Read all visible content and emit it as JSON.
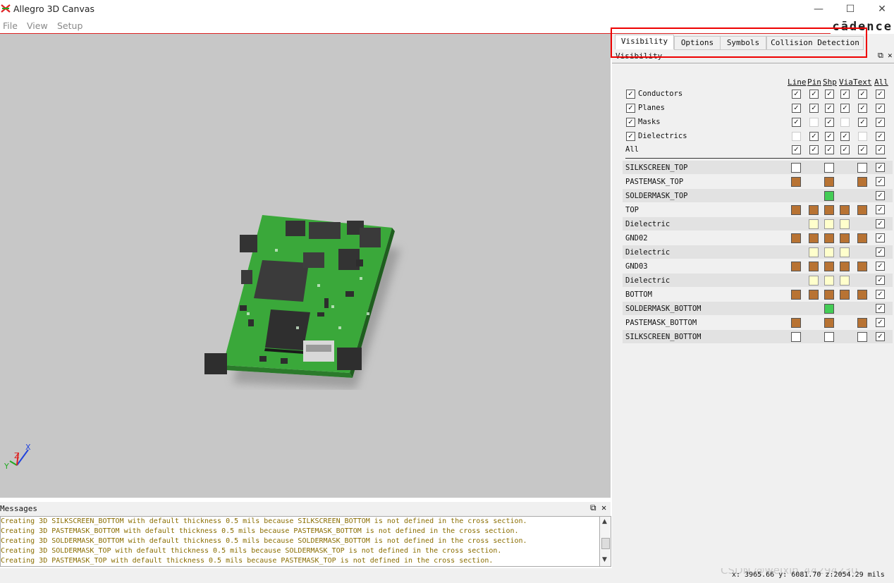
{
  "window": {
    "title": "Allegro 3D Canvas",
    "controls": {
      "minimize": "—",
      "maximize": "☐",
      "close": "✕"
    }
  },
  "menu": [
    "File",
    "View",
    "Setup"
  ],
  "brand": "cādence",
  "panel": {
    "tabs": [
      "Visibility",
      "Options",
      "Symbols",
      "Collision Detection"
    ],
    "active_tab": "Visibility",
    "section_title": "Visibility",
    "columns": [
      "Line",
      "Pin",
      "Shp",
      "Via",
      "Text",
      "All"
    ],
    "categories": [
      {
        "label": "Conductors",
        "checked": true,
        "cells": [
          "on",
          "on",
          "on",
          "on",
          "on",
          "on"
        ]
      },
      {
        "label": "Planes",
        "checked": true,
        "cells": [
          "on",
          "on",
          "on",
          "on",
          "on",
          "on"
        ]
      },
      {
        "label": "Masks",
        "checked": true,
        "cells": [
          "on",
          "off",
          "on",
          "off",
          "on",
          "on"
        ]
      },
      {
        "label": "Dielectrics",
        "checked": true,
        "cells": [
          "off",
          "on",
          "on",
          "on",
          "off",
          "on"
        ]
      },
      {
        "label": "All",
        "checked": null,
        "cells": [
          "on",
          "on",
          "on",
          "on",
          "on",
          "on"
        ]
      }
    ],
    "colors": {
      "copper": "#b87333",
      "dielectric": "#ffffcc",
      "mask_green": "#44cc55",
      "white": "#ffffff"
    },
    "layers": [
      {
        "name": "SILKSCREEN_TOP",
        "cells": [
          "white",
          null,
          "white",
          null,
          "white",
          "check"
        ]
      },
      {
        "name": "PASTEMASK_TOP",
        "cells": [
          "copper",
          null,
          "copper",
          null,
          "copper",
          "check"
        ]
      },
      {
        "name": "SOLDERMASK_TOP",
        "cells": [
          null,
          null,
          "mask_green",
          null,
          null,
          "check"
        ]
      },
      {
        "name": "TOP",
        "cells": [
          "copper",
          "copper",
          "copper",
          "copper",
          "copper",
          "check"
        ]
      },
      {
        "name": "Dielectric",
        "cells": [
          null,
          "dielectric",
          "dielectric",
          "dielectric",
          null,
          "check"
        ]
      },
      {
        "name": "GND02",
        "cells": [
          "copper",
          "copper",
          "copper",
          "copper",
          "copper",
          "check"
        ]
      },
      {
        "name": "Dielectric",
        "cells": [
          null,
          "dielectric",
          "dielectric",
          "dielectric",
          null,
          "check"
        ]
      },
      {
        "name": "GND03",
        "cells": [
          "copper",
          "copper",
          "copper",
          "copper",
          "copper",
          "check"
        ]
      },
      {
        "name": "Dielectric",
        "cells": [
          null,
          "dielectric",
          "dielectric",
          "dielectric",
          null,
          "check"
        ]
      },
      {
        "name": "BOTTOM",
        "cells": [
          "copper",
          "copper",
          "copper",
          "copper",
          "copper",
          "check"
        ]
      },
      {
        "name": "SOLDERMASK_BOTTOM",
        "cells": [
          null,
          null,
          "mask_green",
          null,
          null,
          "check"
        ]
      },
      {
        "name": "PASTEMASK_BOTTOM",
        "cells": [
          "copper",
          null,
          "copper",
          null,
          "copper",
          "check"
        ]
      },
      {
        "name": "SILKSCREEN_BOTTOM",
        "cells": [
          "white",
          null,
          "white",
          null,
          "white",
          "check"
        ]
      }
    ]
  },
  "axis": {
    "x": "X",
    "y": "Y",
    "z": "Z"
  },
  "messages": {
    "title": "Messages",
    "lines": [
      "Creating 3D SILKSCREEN_BOTTOM with default thickness 0.5 mils because SILKSCREEN_BOTTOM is not defined in the cross section.",
      "Creating 3D PASTEMASK_BOTTOM with default thickness 0.5 mils because PASTEMASK_BOTTOM is not defined in the cross section.",
      "Creating 3D SOLDERMASK_BOTTOM with default thickness 0.5 mils because SOLDERMASK_BOTTOM is not defined in the cross section.",
      "Creating 3D SOLDERMASK_TOP with default thickness 0.5 mils because SOLDERMASK_TOP is not defined in the cross section.",
      "Creating 3D PASTEMASK_TOP with default thickness 0.5 mils because PASTEMASK_TOP is not defined in the cross section."
    ]
  },
  "status": {
    "coordinates": "x: 3965.66 y: 6081.70 z:2054.29 mils",
    "watermark": "CSDN @weixin_44294230"
  }
}
